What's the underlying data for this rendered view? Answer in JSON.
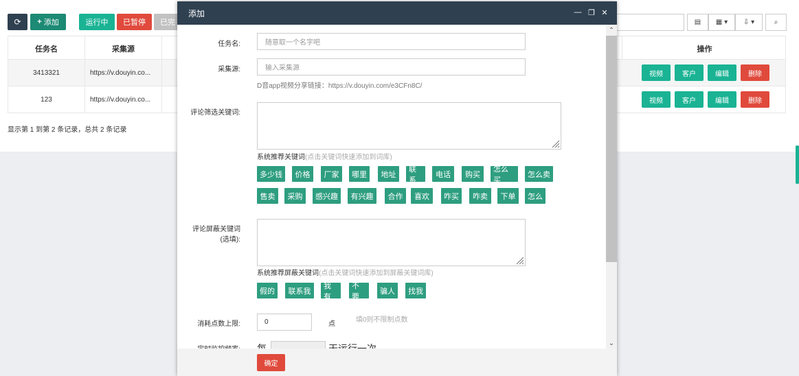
{
  "toolbar": {
    "refresh_icon": "refresh-icon",
    "add_label": "添加",
    "running_label": "运行中",
    "paused_label": "已暂停",
    "done_label": "已完"
  },
  "table": {
    "headers": [
      "任务名",
      "采集源",
      "操作"
    ],
    "rows": [
      {
        "name": "3413321",
        "source": "https://v.douyin.co..."
      },
      {
        "name": "123",
        "source": "https://v.douyin.co..."
      }
    ],
    "actions": [
      "视频",
      "客户",
      "编辑",
      "删除"
    ],
    "summary": "显示第 1 到第 2 条记录，总共 2 条记录"
  },
  "modal": {
    "title": "添加",
    "fields": {
      "task_name_label": "任务名:",
      "task_name_placeholder": "随意取一个名字吧",
      "source_label": "采集源:",
      "source_placeholder": "输入采集源",
      "source_hint": "D音app视频分享链接：https://v.douyin.com/e3CFn8C/",
      "filter_label": "评论筛选关键词:",
      "recommend_title": "系统推荐关键词",
      "recommend_sub": "(点击关键词快速添加到词库)",
      "recommend_keywords_row1": [
        "多少钱",
        "价格",
        "厂家",
        "哪里",
        "地址",
        "联系",
        "电话",
        "购买",
        "怎么买",
        "怎么卖"
      ],
      "recommend_keywords_row2": [
        "售卖",
        "采购",
        "感兴趣",
        "有兴趣",
        "合作",
        "喜欢",
        "咋买",
        "咋卖",
        "下单",
        "怎么"
      ],
      "block_label_1": "评论屏蔽关键词",
      "block_label_2": "(选填):",
      "block_title": "系统推荐屏蔽关键词",
      "block_sub": "(点击关键词快速添加到屏蔽关键词库)",
      "block_keywords": [
        "假的",
        "联系我",
        "我有",
        "不要",
        "骗人",
        "找我"
      ],
      "points_label": "消耗点数上限:",
      "points_value": "0",
      "points_unit": "点",
      "points_hint": "填0则不限制点数",
      "timer_label": "定时监控频率:",
      "timer_prefix": "每",
      "timer_suffix": "天运行一次"
    },
    "confirm_label": "确定"
  },
  "colors": {
    "header": "#2f4050",
    "green": "#1ab394",
    "keyword": "#2e9e80",
    "red": "#e04a3c"
  }
}
